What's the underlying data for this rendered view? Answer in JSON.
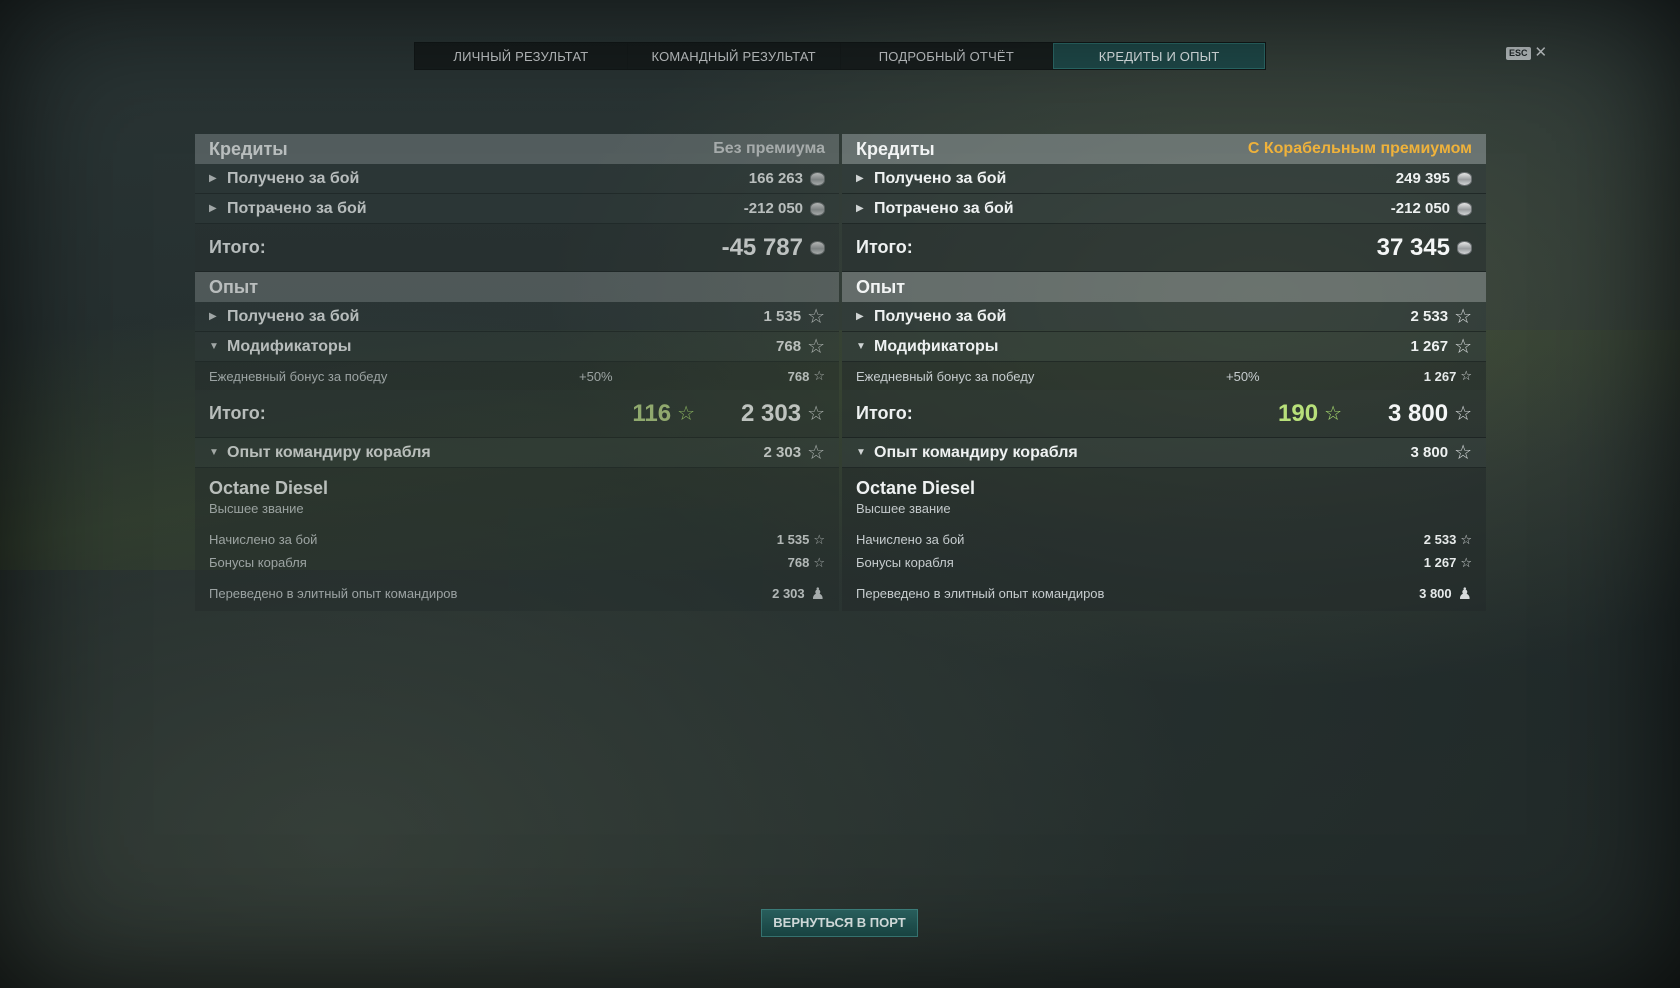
{
  "tabs": [
    "ЛИЧНЫЙ РЕЗУЛЬТАТ",
    "КОМАНДНЫЙ РЕЗУЛЬТАТ",
    "ПОДРОБНЫЙ ОТЧЁТ",
    "КРЕДИТЫ И ОПЫТ"
  ],
  "active_tab": "КРЕДИТЫ И ОПЫТ",
  "esc": {
    "key": "ESC",
    "close": "✕"
  },
  "left": {
    "credits_title": "Кредиты",
    "credits_sub": "Без премиума",
    "earned_label": "Получено за бой",
    "earned_value": "166 263",
    "spent_label": "Потрачено за бой",
    "spent_value": "-212 050",
    "credits_total_label": "Итого:",
    "credits_total": "-45 787",
    "xp_title": "Опыт",
    "xp_earned_label": "Получено за бой",
    "xp_earned_value": "1 535",
    "modifiers_label": "Модификаторы",
    "modifiers_value": "768",
    "daily_label": "Ежедневный бонус за победу",
    "daily_pct": "+50%",
    "daily_value": "768",
    "xp_total_label": "Итого:",
    "xp_total_free": "116",
    "xp_total": "2 303",
    "cmdr_xp_label": "Опыт командиру корабля",
    "cmdr_xp_value": "2 303",
    "cmdr_name": "Octane Diesel",
    "cmdr_rank": "Высшее звание",
    "accrued_label": "Начислено за бой",
    "accrued_value": "1 535",
    "ship_bonus_label": "Бонусы корабля",
    "ship_bonus_value": "768",
    "elite_label": "Переведено в элитный опыт командиров",
    "elite_value": "2 303"
  },
  "right": {
    "credits_title": "Кредиты",
    "credits_sub": "С Корабельным премиумом",
    "earned_label": "Получено за бой",
    "earned_value": "249 395",
    "spent_label": "Потрачено за бой",
    "spent_value": "-212 050",
    "credits_total_label": "Итого:",
    "credits_total": "37 345",
    "xp_title": "Опыт",
    "xp_earned_label": "Получено за бой",
    "xp_earned_value": "2 533",
    "modifiers_label": "Модификаторы",
    "modifiers_value": "1 267",
    "daily_label": "Ежедневный бонус за победу",
    "daily_pct": "+50%",
    "daily_value": "1 267",
    "xp_total_label": "Итого:",
    "xp_total_free": "190",
    "xp_total": "3 800",
    "cmdr_xp_label": "Опыт командиру корабля",
    "cmdr_xp_value": "3 800",
    "cmdr_name": "Octane Diesel",
    "cmdr_rank": "Высшее звание",
    "accrued_label": "Начислено за бой",
    "accrued_value": "2 533",
    "ship_bonus_label": "Бонусы корабля",
    "ship_bonus_value": "1 267",
    "elite_label": "Переведено в элитный опыт командиров",
    "elite_value": "3 800"
  },
  "return_button": "ВЕРНУТЬСЯ В ПОРТ",
  "colors": {
    "accent": "#1f4a4a",
    "premium": "#f0b33c",
    "free_xp": "#b8e07a"
  },
  "icons": {
    "credits": "credit-coin-icon",
    "xp": "star-icon",
    "elite": "commander-icon"
  }
}
